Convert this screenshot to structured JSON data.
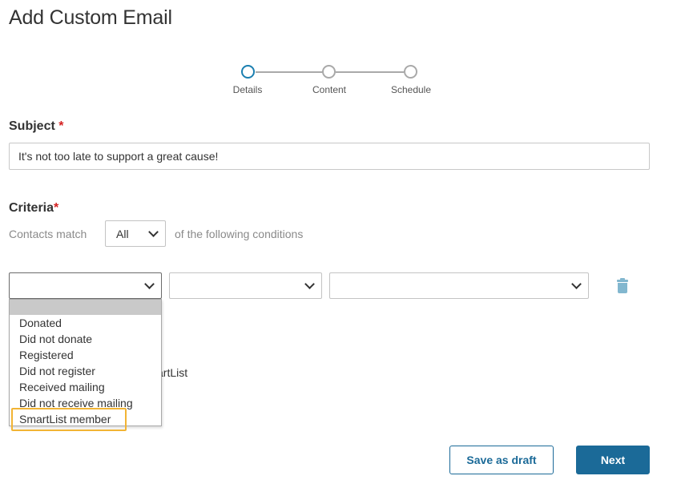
{
  "page": {
    "title": "Add Custom Email"
  },
  "stepper": {
    "steps": [
      {
        "label": "Details",
        "active": true
      },
      {
        "label": "Content",
        "active": false
      },
      {
        "label": "Schedule",
        "active": false
      }
    ]
  },
  "subject": {
    "label": "Subject",
    "required_mark": "*",
    "value": "It's not too late to support a great cause!"
  },
  "criteria": {
    "label": "Criteria",
    "required_mark": "*",
    "contacts_match_label": "Contacts match",
    "match_select_value": "All",
    "conditions_suffix": "of the following conditions",
    "condition_row": {
      "field_value": "",
      "operator_value": "",
      "value_value": ""
    },
    "behind_dropdown_text": "artList"
  },
  "dropdown": {
    "options": [
      "",
      "Donated",
      "Did not donate",
      "Registered",
      "Did not register",
      "Received mailing",
      "Did not receive mailing",
      "SmartList member"
    ],
    "highlighted_option": "SmartList member"
  },
  "footer": {
    "save_draft_label": "Save as draft",
    "next_label": "Next"
  },
  "colors": {
    "primary": "#1b6a98",
    "active_step": "#1b7fb0",
    "required": "#d42020",
    "highlight_outline": "#f2b434",
    "trash_icon": "#82b7cf"
  },
  "icons": [
    "chevron-down-icon",
    "trash-icon"
  ]
}
